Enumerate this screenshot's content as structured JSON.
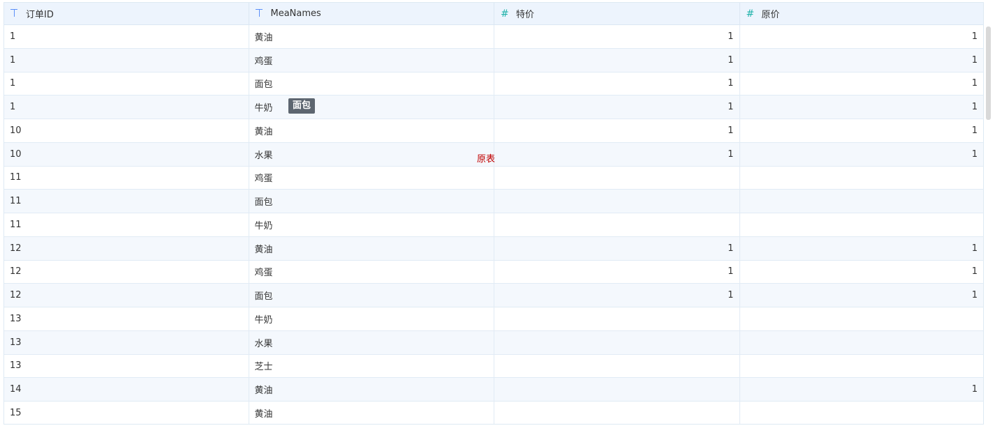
{
  "columns": [
    {
      "type_icon": "text-type-icon",
      "label": "订单ID"
    },
    {
      "type_icon": "text-type-icon",
      "label": "MeaNames"
    },
    {
      "type_icon": "number-type-icon",
      "label": "特价",
      "glyph": "#"
    },
    {
      "type_icon": "number-type-icon",
      "label": "原价",
      "glyph": "#"
    }
  ],
  "rows": [
    {
      "id": "1",
      "name": "黄油",
      "special": "1",
      "original": "1"
    },
    {
      "id": "1",
      "name": "鸡蛋",
      "special": "1",
      "original": "1"
    },
    {
      "id": "1",
      "name": "面包",
      "special": "1",
      "original": "1"
    },
    {
      "id": "1",
      "name": "牛奶",
      "special": "1",
      "original": "1"
    },
    {
      "id": "10",
      "name": "黄油",
      "special": "1",
      "original": "1"
    },
    {
      "id": "10",
      "name": "水果",
      "special": "1",
      "original": "1"
    },
    {
      "id": "11",
      "name": "鸡蛋",
      "special": "",
      "original": ""
    },
    {
      "id": "11",
      "name": "面包",
      "special": "",
      "original": ""
    },
    {
      "id": "11",
      "name": "牛奶",
      "special": "",
      "original": ""
    },
    {
      "id": "12",
      "name": "黄油",
      "special": "1",
      "original": "1"
    },
    {
      "id": "12",
      "name": "鸡蛋",
      "special": "1",
      "original": "1"
    },
    {
      "id": "12",
      "name": "面包",
      "special": "1",
      "original": "1"
    },
    {
      "id": "13",
      "name": "牛奶",
      "special": "",
      "original": ""
    },
    {
      "id": "13",
      "name": "水果",
      "special": "",
      "original": ""
    },
    {
      "id": "13",
      "name": "芝士",
      "special": "",
      "original": ""
    },
    {
      "id": "14",
      "name": "黄油",
      "special": "",
      "original": "1"
    },
    {
      "id": "15",
      "name": "黄油",
      "special": "",
      "original": ""
    }
  ],
  "tooltip": {
    "text": "面包"
  },
  "floating_label": {
    "text": "原表",
    "color": "#c00000"
  },
  "colors": {
    "header_bg": "#edf4fd",
    "alt_row_bg": "#f4f8fd",
    "text_type": "#5b8ff9",
    "number_type": "#20b2aa"
  }
}
